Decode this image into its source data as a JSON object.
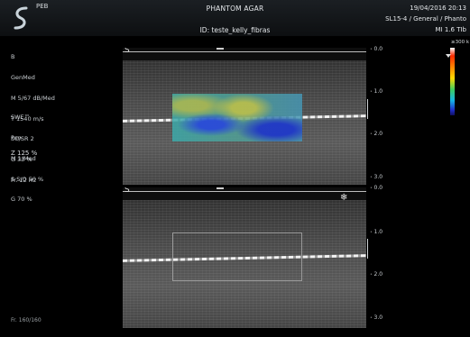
{
  "header": {
    "peb": "PEB",
    "title": "PHANTOM AGAR",
    "study_id": "ID: teste_kelly_fibras",
    "date": "19/04/2016 20:13",
    "preset": "SL15-4 / General / Phanto",
    "mi": "MI 1.6  TIb"
  },
  "b_mode_params": [
    "B",
    "GenMed",
    "M 5/67 dB/Med",
    "T 1540 m/s",
    "SC/SR 2",
    "G 33 %",
    "Fr. 12 Hz"
  ],
  "swe_params": [
    "SWE™",
    "Pen",
    "M 1/Med",
    "S S/O 50 %",
    "G 70 %"
  ],
  "zoom": "Z  125  %",
  "frame_counter": "Fr. 160/160",
  "image_top": {
    "marker": "S"
  },
  "image_bottom": {
    "marker": "S"
  },
  "depth_top": [
    "0.0",
    "1.0",
    "2.0",
    "3.0"
  ],
  "depth_bottom": [
    "0.0",
    "1.0",
    "2.0",
    "3.0"
  ],
  "color_bar": {
    "label": "≥300 k",
    "colors": [
      "#ffffff",
      "#ff2a00",
      "#ff8c00",
      "#ffd800",
      "#3ccc60",
      "#15b5e6",
      "#1e2ec8"
    ]
  },
  "icons": {
    "logo": "probe-logo-icon",
    "freeze": "snowflake-icon"
  }
}
